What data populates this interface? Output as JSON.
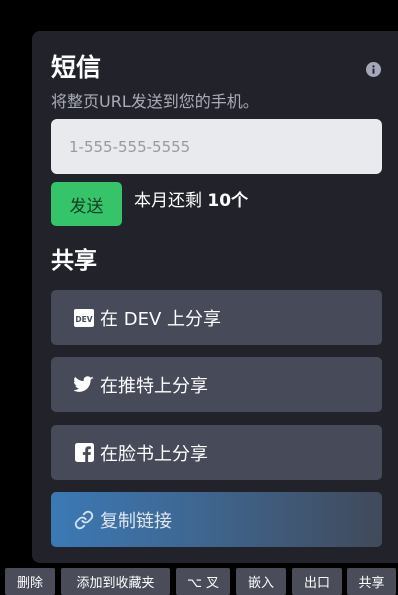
{
  "sms": {
    "title": "短信",
    "description": "将整页URL发送到您的手机。",
    "phone_placeholder": "1-555-555-5555",
    "send_label": "发送",
    "quota_prefix": "本月还剩 ",
    "quota_count": "10个"
  },
  "share": {
    "title": "共享",
    "buttons": [
      {
        "label": "在 DEV 上分享",
        "icon": "dev-icon"
      },
      {
        "label": "在推特上分享",
        "icon": "twitter-icon"
      },
      {
        "label": "在脸书上分享",
        "icon": "facebook-icon"
      },
      {
        "label": "复制链接",
        "icon": "link-icon"
      }
    ]
  },
  "bottom_bar": {
    "delete": "删除",
    "add_favorites": "添加到收藏夹",
    "fork": "⌥ 叉",
    "embed": "嵌入",
    "export": "出口",
    "share": "共享"
  },
  "colors": {
    "panel_bg": "#22232a",
    "send_green": "#35c46a",
    "share_button_bg": "#474a58",
    "copy_gradient_start": "#3b79b5"
  }
}
